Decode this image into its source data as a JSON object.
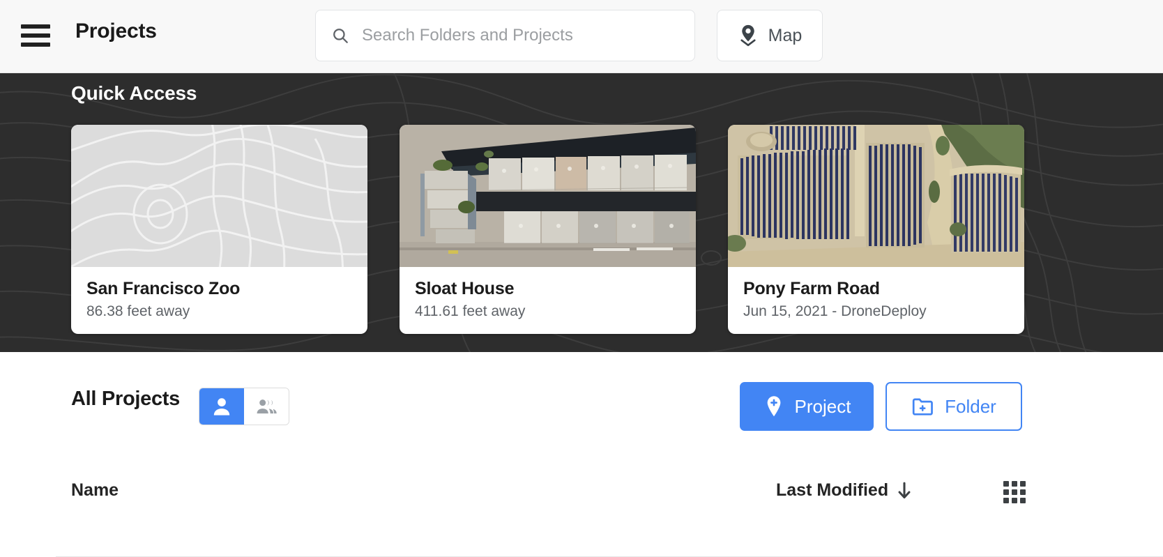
{
  "topbar": {
    "menu_icon": "hamburger-icon",
    "title": "Projects",
    "search": {
      "icon": "search-icon",
      "placeholder": "Search Folders and Projects",
      "value": ""
    },
    "map_button": {
      "icon": "map-pin-icon",
      "label": "Map"
    }
  },
  "quick_access": {
    "heading": "Quick Access",
    "cards": [
      {
        "name": "San Francisco Zoo",
        "subtitle": "86.38 feet away",
        "thumb": "topo-placeholder"
      },
      {
        "name": "Sloat House",
        "subtitle": "411.61 feet away",
        "thumb": "aerial-rooftops"
      },
      {
        "name": "Pony Farm Road",
        "subtitle": "Jun 15, 2021 - DroneDeploy",
        "thumb": "aerial-solar-farm"
      }
    ]
  },
  "all_projects": {
    "heading": "All Projects",
    "view_toggle": {
      "options": [
        {
          "icon": "person-icon",
          "selected": true
        },
        {
          "icon": "people-group-icon",
          "selected": false
        }
      ]
    },
    "new_project_button": {
      "icon": "add-location-pin-icon",
      "label": "Project"
    },
    "new_folder_button": {
      "icon": "add-folder-icon",
      "label": "Folder"
    }
  },
  "table": {
    "columns": [
      {
        "label": "Name"
      },
      {
        "label": "Last Modified",
        "sort_icon": "arrow-down-icon"
      }
    ],
    "grid_view_icon": "grid-view-icon",
    "rows": []
  },
  "colors": {
    "accent": "#4285f4",
    "hero_background": "#2d2d2d",
    "topbar_background": "#f8f8f8",
    "text_primary": "#1b1b1b",
    "text_secondary": "#5f6368"
  }
}
